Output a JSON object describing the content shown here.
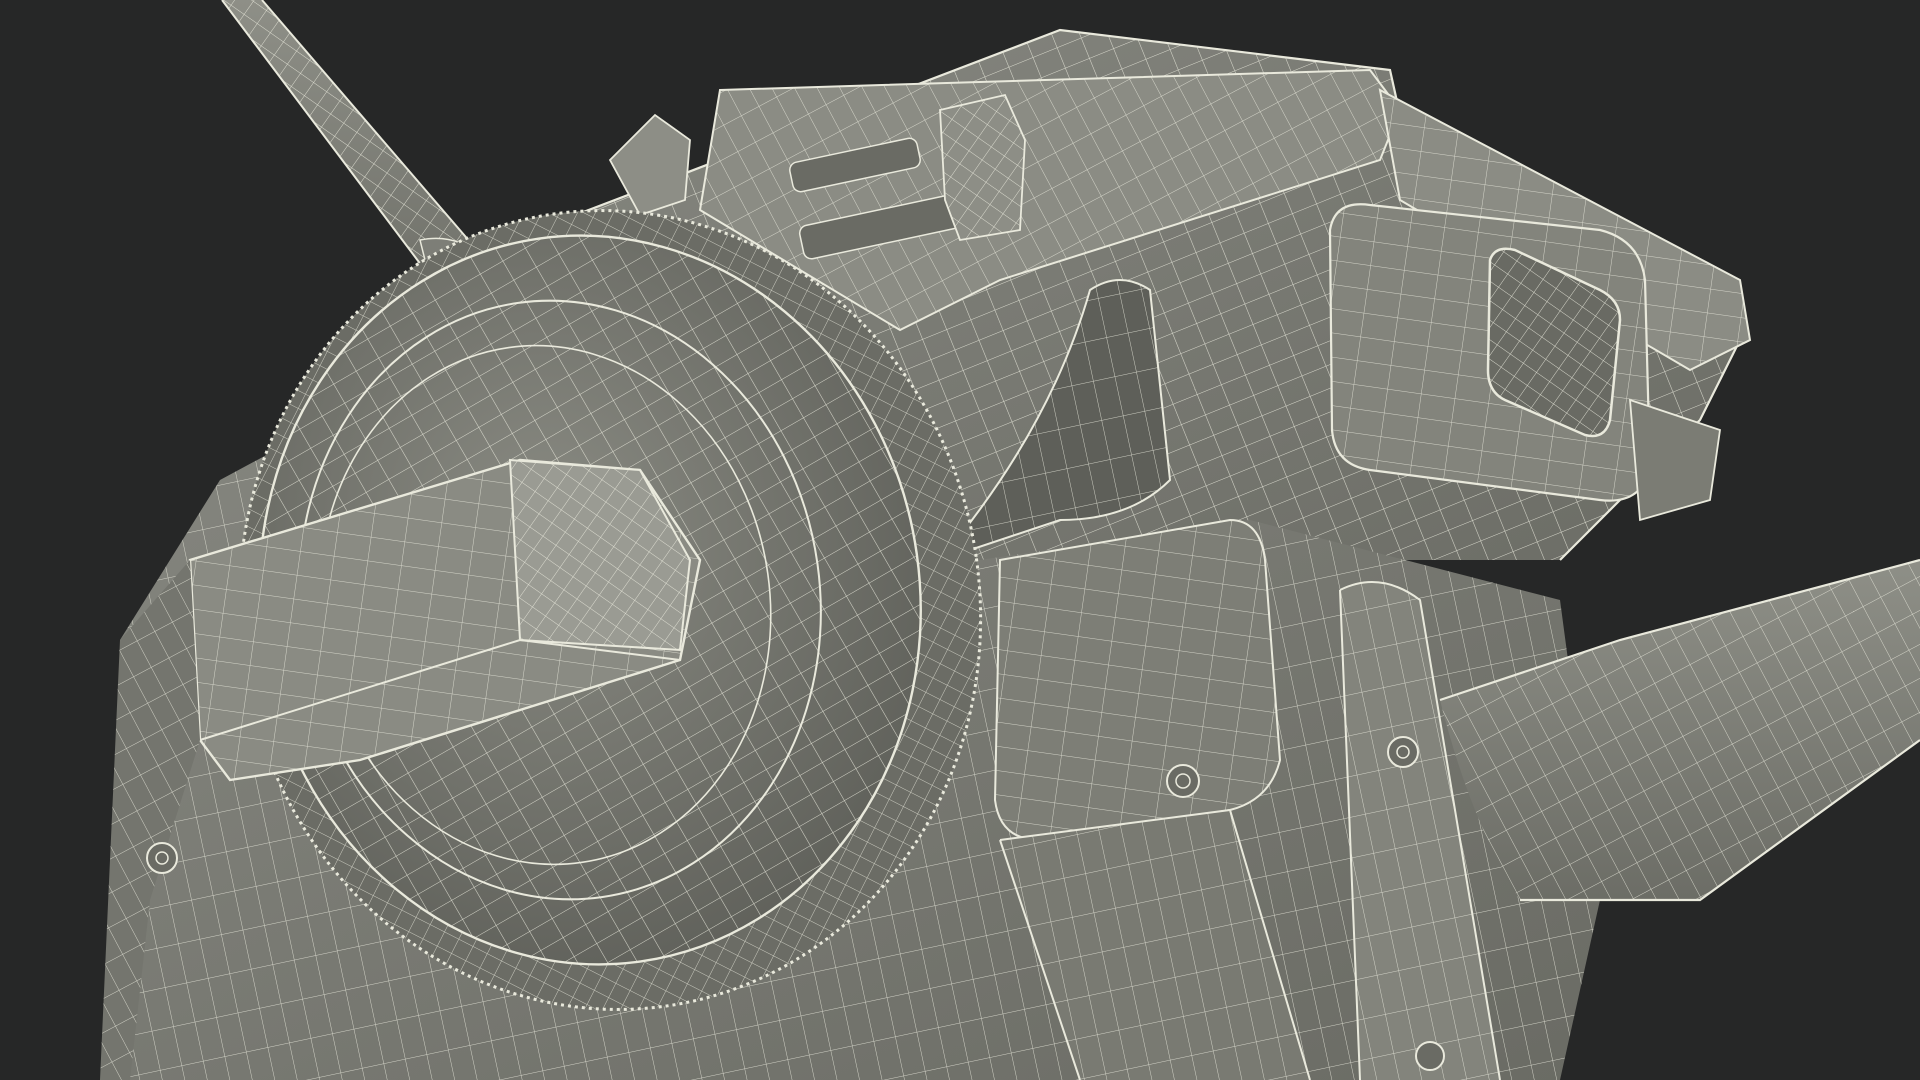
{
  "scene": {
    "subject": "wireframe-render",
    "colors": {
      "background": "#262727",
      "surface": "#7b7c74",
      "surface_dark": "#5f605a",
      "surface_light": "#8f9088",
      "wire": "#e9e9dc"
    }
  }
}
